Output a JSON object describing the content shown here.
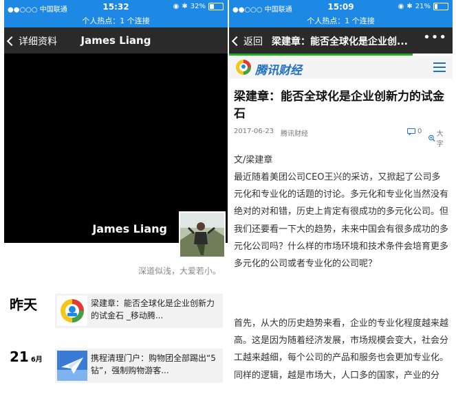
{
  "left": {
    "status": {
      "carrier": "●●○○○ 中国联通",
      "time": "15:32",
      "battery": "32%",
      "battery_level": 0.32
    },
    "hotspot": "个人热点：1 个连接",
    "nav": {
      "back_label": "详细资料",
      "title": "James Liang"
    },
    "cover_name": "James Liang",
    "signature": "深道似浅，大爱若小。",
    "moments": [
      {
        "day": "昨天",
        "month": "",
        "text": "梁建章：能否全球化是企业创新力的试金石 _移动腾..."
      },
      {
        "day": "21",
        "month": "6月",
        "text": "携程清理门户：购物团全部踢出“5钻”，强制购物游客..."
      }
    ]
  },
  "right": {
    "status": {
      "carrier": "●●○○○ 中国联通",
      "time": "15:09",
      "battery": "21%",
      "battery_level": 0.21
    },
    "hotspot": "个人热点：1 个连接",
    "nav": {
      "back_label": "返回",
      "title": "梁建章：能否全球化是企业创...",
      "more": "•••"
    },
    "page_load_progress": 0.82,
    "site_logo": "腾讯财经",
    "article": {
      "title": "梁建章：能否全球化是企业创新力的试金石",
      "date": "2017-06-23",
      "source": "腾讯财经",
      "comment_count": "0",
      "font_label": "大字",
      "byline": "文/梁建章",
      "paragraphs": [
        "最近随着美团公司CEO王兴的采访，又掀起了公司多元化和专业化的话题的讨论。多元化和专业化当然没有绝对的对和错，历史上肯定有很成功的多元化公司。但我们还要看一下大的趋势，未来中国会有很多成功的多元化公司吗？什么样的市场环境和技术条件会培育更多多元化的公司或者专业化的公司呢？",
        "首先，从大的历史趋势来看，企业的专业化程度越来越高。这是因为随着经济发展，市场规模会变大，社会分工越来越细，每个公司的产品和服务也会更加专业化。同样的逻辑，越是市场大，人口多的国家，产业的分"
      ]
    }
  },
  "colors": {
    "status_bar": "#1E88E5",
    "nav_bar": "#2a2a2a",
    "progress": "#1AAD19",
    "brand_blue": "#1F6FC5"
  }
}
